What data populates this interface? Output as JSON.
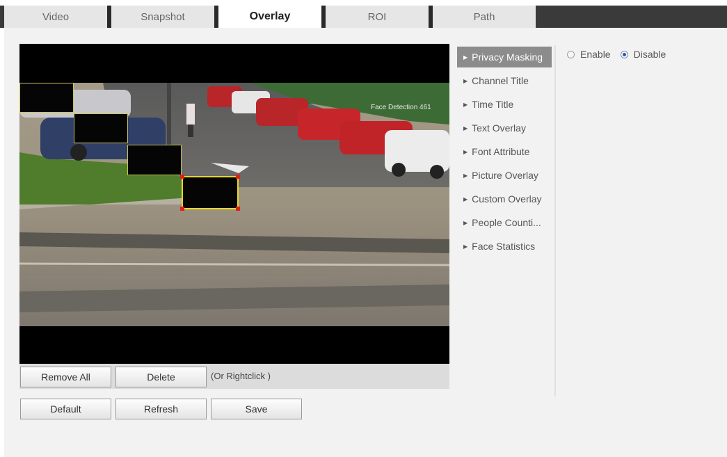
{
  "tabs": [
    {
      "label": "Video",
      "active": false
    },
    {
      "label": "Snapshot",
      "active": false
    },
    {
      "label": "Overlay",
      "active": true
    },
    {
      "label": "ROI",
      "active": false
    },
    {
      "label": "Path",
      "active": false
    }
  ],
  "video": {
    "overlay_text": "Face Detection 461"
  },
  "actions": {
    "remove_all": "Remove All",
    "delete": "Delete",
    "hint": "(Or Rightclick )"
  },
  "footer": {
    "default": "Default",
    "refresh": "Refresh",
    "save": "Save"
  },
  "menu": [
    {
      "label": "Privacy Masking",
      "active": true
    },
    {
      "label": "Channel Title",
      "active": false
    },
    {
      "label": "Time Title",
      "active": false
    },
    {
      "label": "Text Overlay",
      "active": false
    },
    {
      "label": "Font Attribute",
      "active": false
    },
    {
      "label": "Picture Overlay",
      "active": false
    },
    {
      "label": "Custom Overlay",
      "active": false
    },
    {
      "label": "People Counti...",
      "active": false
    },
    {
      "label": "Face Statistics",
      "active": false
    }
  ],
  "mode": {
    "enable_label": "Enable",
    "disable_label": "Disable",
    "selected": "Disable"
  },
  "colors": {
    "active_menu": "#8c8c8c",
    "tab_bar": "#3a3a3a",
    "mask_border": "#e8d628",
    "handle": "#e0201a"
  }
}
